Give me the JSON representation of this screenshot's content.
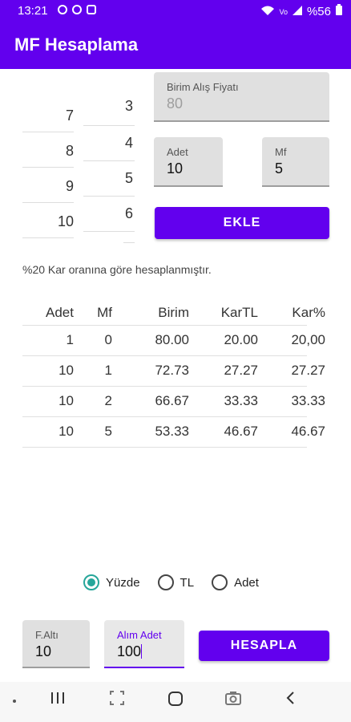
{
  "status": {
    "time": "13:21",
    "battery": "%56",
    "icons_left": [
      "anchor-icon",
      "browser-icon",
      "image-icon"
    ],
    "icons_right": [
      "wifi-icon",
      "volte-icon",
      "signal-icon",
      "battery-icon"
    ]
  },
  "app": {
    "title": "MF Hesaplama"
  },
  "picker_left": [
    "7",
    "8",
    "9",
    "10"
  ],
  "picker_right": [
    "3",
    "4",
    "5",
    "6"
  ],
  "fields": {
    "birim_label": "Birim Alış Fiyatı",
    "birim_hint": "80",
    "adet_label": "Adet",
    "adet_value": "10",
    "mf_label": "Mf",
    "mf_value": "5"
  },
  "buttons": {
    "ekle": "EKLE",
    "hesapla": "HESAPLA"
  },
  "note": "%20 Kar oranına göre hesaplanmıştır.",
  "table": {
    "headers": [
      "Adet",
      "Mf",
      "Birim",
      "KarTL",
      "Kar%"
    ],
    "rows": [
      [
        "1",
        "0",
        "80.00",
        "20.00",
        "20,00"
      ],
      [
        "10",
        "1",
        "72.73",
        "27.27",
        "27.27"
      ],
      [
        "10",
        "2",
        "66.67",
        "33.33",
        "33.33"
      ],
      [
        "10",
        "5",
        "53.33",
        "46.67",
        "46.67"
      ]
    ]
  },
  "radios": [
    "Yüzde",
    "TL",
    "Adet"
  ],
  "bottom": {
    "faltı_label": "F.Altı",
    "faltı_value": "10",
    "alim_label": "Alım Adet",
    "alim_value": "100"
  },
  "colors": {
    "primary": "#6200ee",
    "radio_accent": "#26a69a"
  }
}
